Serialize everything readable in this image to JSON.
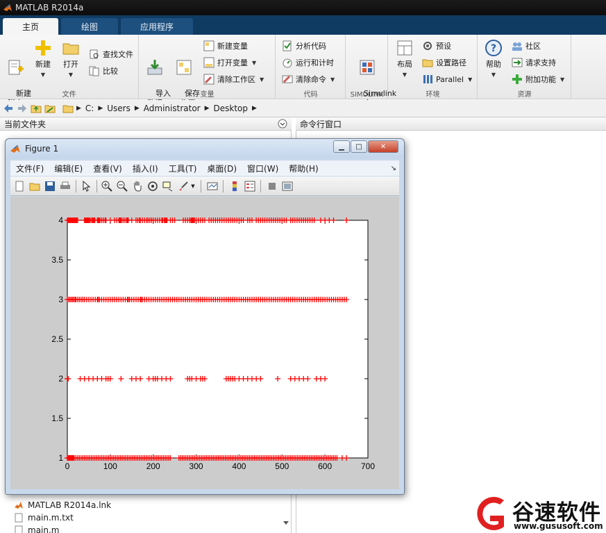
{
  "app": {
    "window_title": "MATLAB R2014a"
  },
  "tabs": [
    {
      "label": "主页",
      "active": true
    },
    {
      "label": "绘图",
      "active": false
    },
    {
      "label": "应用程序",
      "active": false
    }
  ],
  "ribbon": {
    "file_group": {
      "label": "文件",
      "new_script": "新建\n脚本",
      "new": "新建",
      "open": "打开",
      "find_files": "查找文件",
      "compare": "比较"
    },
    "variable_group": {
      "label": "变量",
      "import_data": "导入\n数据",
      "save_workspace": "保存\n工作区",
      "new_variable": "新建变量",
      "open_variable": "打开变量",
      "clear_workspace": "清除工作区"
    },
    "code_group": {
      "label": "代码",
      "analyze_code": "分析代码",
      "run_and_time": "运行和计时",
      "clear_commands": "清除命令"
    },
    "simulink_group": {
      "label": "SIMULINK",
      "simulink_library": "Simulink\n库"
    },
    "environment_group": {
      "label": "环境",
      "layout": "布局",
      "preferences": "预设",
      "set_path": "设置路径",
      "parallel": "Parallel"
    },
    "resources_group": {
      "label": "资源",
      "help": "帮助",
      "community": "社区",
      "request_support": "请求支持",
      "add_ons": "附加功能"
    }
  },
  "address": {
    "path": [
      "C:",
      "Users",
      "Administrator",
      "Desktop"
    ]
  },
  "panels": {
    "current_folder": "当前文件夹",
    "command_window": "命令行窗口"
  },
  "files": [
    {
      "name": "MATLAB R2014a.lnk"
    },
    {
      "name": "main.m.txt"
    },
    {
      "name": "main.m"
    }
  ],
  "figure": {
    "title": "Figure 1",
    "menu": [
      "文件(F)",
      "编辑(E)",
      "查看(V)",
      "插入(I)",
      "工具(T)",
      "桌面(D)",
      "窗口(W)",
      "帮助(H)"
    ]
  },
  "chart_data": {
    "type": "scatter",
    "marker": "+",
    "color": "#ff0000",
    "xlim": [
      0,
      700
    ],
    "ylim": [
      1,
      4
    ],
    "xticks": [
      0,
      100,
      200,
      300,
      400,
      500,
      600,
      700
    ],
    "yticks": [
      1,
      1.5,
      2,
      2.5,
      3,
      3.5,
      4
    ],
    "ytick_labels": [
      "1",
      "1.5",
      "2",
      "2.5",
      "3",
      "3.5",
      "4"
    ],
    "series": [
      {
        "y": 4,
        "x": [
          0,
          2,
          4,
          6,
          8,
          10,
          12,
          14,
          16,
          18,
          20,
          22,
          24,
          40,
          42,
          44,
          46,
          48,
          50,
          52,
          55,
          58,
          60,
          62,
          64,
          70,
          72,
          74,
          76,
          80,
          84,
          88,
          90,
          100,
          110,
          115,
          120,
          122,
          124,
          126,
          130,
          134,
          138,
          140,
          142,
          150,
          160,
          164,
          168,
          170,
          175,
          180,
          185,
          188,
          192,
          196,
          200,
          205,
          210,
          215,
          220,
          222,
          226,
          228,
          230,
          232,
          240,
          245,
          250,
          270,
          275,
          280,
          285,
          288,
          290,
          292,
          294,
          296,
          300,
          305,
          310,
          315,
          320,
          330,
          335,
          340,
          345,
          350,
          355,
          360,
          365,
          370,
          375,
          380,
          385,
          390,
          395,
          400,
          405,
          410,
          420,
          425,
          430,
          440,
          445,
          450,
          455,
          460,
          465,
          470,
          475,
          480,
          485,
          490,
          495,
          500,
          505,
          510,
          520,
          525,
          530,
          535,
          540,
          545,
          550,
          555,
          560,
          565,
          570,
          575,
          590,
          600,
          610,
          620,
          650
        ]
      },
      {
        "y": 3,
        "x": [
          0,
          3,
          6,
          9,
          12,
          15,
          18,
          20,
          24,
          28,
          32,
          36,
          40,
          45,
          50,
          55,
          60,
          65,
          70,
          72,
          75,
          80,
          85,
          90,
          95,
          100,
          105,
          110,
          115,
          120,
          125,
          130,
          135,
          140,
          142,
          145,
          150,
          155,
          160,
          165,
          170,
          172,
          175,
          180,
          185,
          190,
          195,
          200,
          205,
          210,
          215,
          220,
          225,
          230,
          235,
          240,
          245,
          250,
          255,
          260,
          265,
          270,
          275,
          280,
          285,
          290,
          295,
          300,
          305,
          310,
          315,
          320,
          325,
          330,
          335,
          340,
          345,
          350,
          355,
          360,
          365,
          370,
          375,
          380,
          385,
          390,
          395,
          400,
          405,
          410,
          415,
          420,
          425,
          430,
          435,
          440,
          445,
          450,
          455,
          460,
          465,
          470,
          475,
          480,
          485,
          490,
          495,
          500,
          505,
          510,
          515,
          520,
          525,
          530,
          535,
          540,
          545,
          550,
          555,
          560,
          565,
          570,
          575,
          580,
          585,
          590,
          595,
          600,
          605,
          610,
          615,
          620,
          625,
          630,
          635,
          640,
          645,
          650
        ]
      },
      {
        "y": 2,
        "x": [
          0,
          2,
          30,
          40,
          50,
          60,
          70,
          80,
          90,
          95,
          100,
          125,
          150,
          160,
          170,
          190,
          200,
          205,
          210,
          220,
          230,
          240,
          280,
          285,
          290,
          300,
          310,
          315,
          320,
          370,
          375,
          380,
          385,
          390,
          400,
          410,
          420,
          430,
          440,
          450,
          490,
          520,
          530,
          540,
          550,
          560,
          580,
          590,
          600
        ]
      },
      {
        "y": 1,
        "x": [
          0,
          2,
          4,
          6,
          8,
          10,
          12,
          14,
          16,
          20,
          24,
          28,
          32,
          36,
          40,
          44,
          48,
          52,
          56,
          60,
          64,
          68,
          72,
          76,
          80,
          84,
          88,
          92,
          96,
          100,
          104,
          108,
          112,
          116,
          120,
          124,
          128,
          132,
          136,
          140,
          144,
          148,
          152,
          156,
          160,
          164,
          168,
          172,
          176,
          180,
          184,
          188,
          192,
          196,
          200,
          204,
          208,
          212,
          216,
          220,
          224,
          228,
          232,
          236,
          240,
          260,
          264,
          268,
          272,
          276,
          280,
          284,
          288,
          292,
          296,
          300,
          304,
          308,
          312,
          316,
          320,
          324,
          328,
          332,
          336,
          340,
          344,
          348,
          352,
          356,
          360,
          364,
          368,
          372,
          376,
          380,
          384,
          388,
          392,
          396,
          400,
          404,
          408,
          412,
          416,
          420,
          424,
          428,
          432,
          436,
          440,
          444,
          448,
          452,
          456,
          460,
          464,
          468,
          472,
          476,
          480,
          484,
          488,
          492,
          496,
          500,
          504,
          508,
          512,
          516,
          520,
          524,
          528,
          532,
          536,
          540,
          544,
          548,
          552,
          556,
          560,
          564,
          568,
          572,
          576,
          580,
          584,
          588,
          592,
          596,
          600,
          604,
          608,
          612,
          616,
          620,
          624,
          628,
          640,
          650
        ]
      }
    ]
  },
  "watermark": {
    "brand": "谷速软件",
    "url": "www.gususoft.com"
  }
}
